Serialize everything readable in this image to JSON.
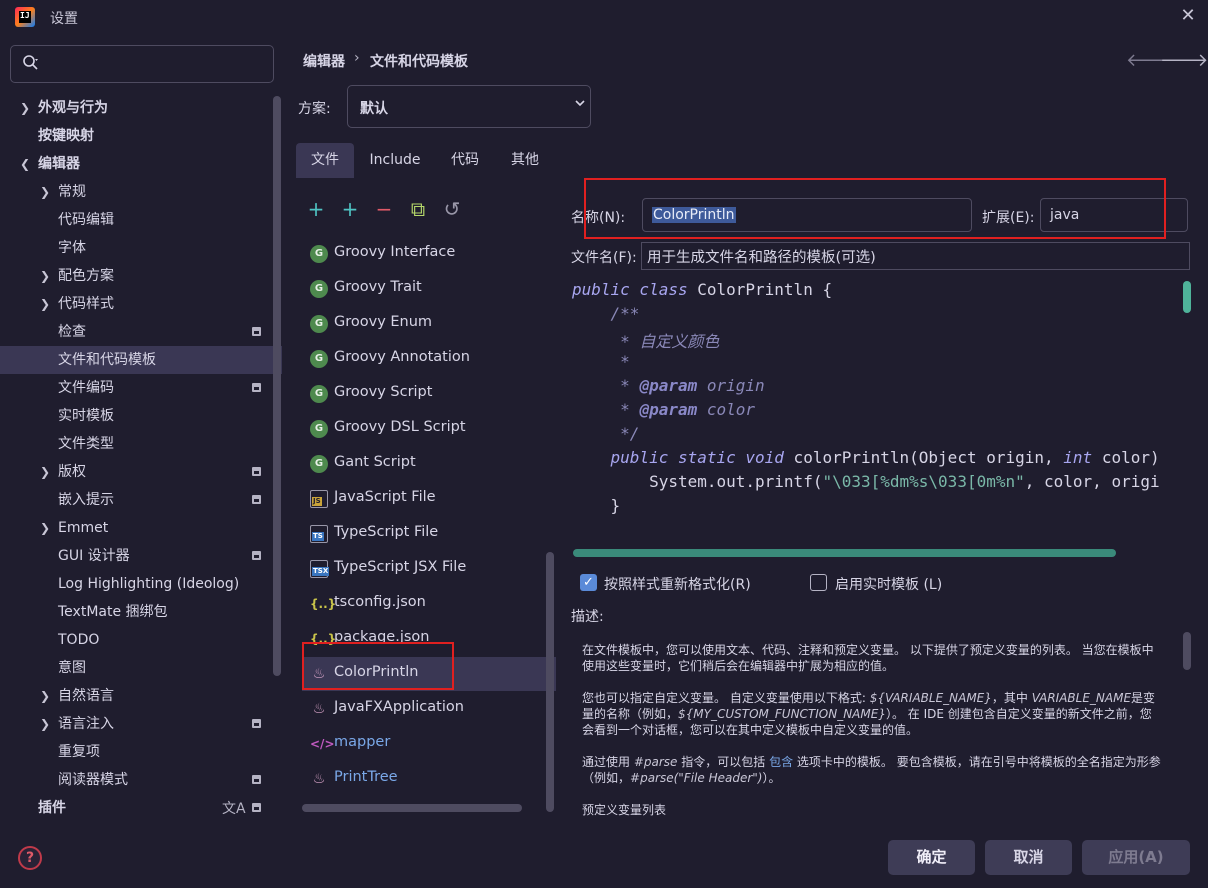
{
  "window": {
    "title": "设置",
    "close_glyph": "✕"
  },
  "search": {
    "placeholder": ""
  },
  "sidebar": {
    "items": [
      {
        "label": "外观与行为"
      },
      {
        "label": "按键映射"
      },
      {
        "label": "编辑器"
      },
      {
        "label": "常规"
      },
      {
        "label": "代码编辑"
      },
      {
        "label": "字体"
      },
      {
        "label": "配色方案"
      },
      {
        "label": "代码样式"
      },
      {
        "label": "检查"
      },
      {
        "label": "文件和代码模板"
      },
      {
        "label": "文件编码"
      },
      {
        "label": "实时模板"
      },
      {
        "label": "文件类型"
      },
      {
        "label": "版权"
      },
      {
        "label": "嵌入提示"
      },
      {
        "label": "Emmet"
      },
      {
        "label": "GUI 设计器"
      },
      {
        "label": "Log Highlighting (Ideolog)"
      },
      {
        "label": "TextMate 捆绑包"
      },
      {
        "label": "TODO"
      },
      {
        "label": "意图"
      },
      {
        "label": "自然语言"
      },
      {
        "label": "语言注入"
      },
      {
        "label": "重复项"
      },
      {
        "label": "阅读器模式"
      },
      {
        "label": "插件"
      }
    ]
  },
  "header": {
    "breadcrumb": [
      "编辑器",
      "文件和代码模板"
    ],
    "separator": "›",
    "back_glyph": "🡐",
    "forward_glyph": "🡒"
  },
  "scheme": {
    "label": "方案:",
    "value": "默认"
  },
  "tabs": [
    {
      "label": "文件"
    },
    {
      "label": "Include"
    },
    {
      "label": "代码"
    },
    {
      "label": "其他"
    }
  ],
  "toolbar": {
    "add": "+",
    "add_child": "+",
    "remove": "−",
    "copy": "⧉",
    "reset": "↺"
  },
  "templates": [
    {
      "name": "Groovy Interface",
      "icon": "G"
    },
    {
      "name": "Groovy Trait",
      "icon": "G"
    },
    {
      "name": "Groovy Enum",
      "icon": "G"
    },
    {
      "name": "Groovy Annotation",
      "icon": "G"
    },
    {
      "name": "Groovy Script",
      "icon": "G"
    },
    {
      "name": "Groovy DSL Script",
      "icon": "G"
    },
    {
      "name": "Gant Script",
      "icon": "G"
    },
    {
      "name": "JavaScript File",
      "icon": "JS"
    },
    {
      "name": "TypeScript File",
      "icon": "TS"
    },
    {
      "name": "TypeScript JSX File",
      "icon": "TSX"
    },
    {
      "name": "tsconfig.json",
      "icon": "{..}"
    },
    {
      "name": "package.json",
      "icon": "{..}"
    },
    {
      "name": "ColorPrintln",
      "icon": "♨"
    },
    {
      "name": "JavaFXApplication",
      "icon": "♨"
    },
    {
      "name": "mapper",
      "icon": "</>"
    },
    {
      "name": "PrintTree",
      "icon": "♨"
    }
  ],
  "form": {
    "name_label": "名称(N):",
    "name_value": "ColorPrintln",
    "ext_label": "扩展(E):",
    "ext_value": "java",
    "filename_label": "文件名(F):",
    "filename_placeholder": "用于生成文件名和路径的模板(可选)"
  },
  "code": {
    "l1_kw": "public class",
    "l1_rest": " ColorPrintln {",
    "l2": "    /**",
    "l3": "     * 自定义颜色",
    "l4": "     *",
    "l5_star": "     * ",
    "l5_tag": "@param",
    "l5_name": " origin",
    "l6_star": "     * ",
    "l6_tag": "@param",
    "l6_name": " color",
    "l7": "     */",
    "l8_kw": "    public static void",
    "l8_a": " colorPrintln(Object origin, ",
    "l8_kw2": "int",
    "l8_b": " color)",
    "l9_a": "        System.out.printf(",
    "l9_str": "\"\\033[%dm%s\\033[0m%n\"",
    "l9_b": ", color, origi",
    "l10": "    }"
  },
  "options": {
    "reformat_label": "按照样式重新格式化(R)",
    "reformat_checked": true,
    "live_label": "启用实时模板 (L)",
    "live_checked": false
  },
  "description": {
    "label": "描述:",
    "p1": "在文件模板中，您可以使用文本、代码、注释和预定义变量。 以下提供了预定义变量的列表。 当您在模板中使用这些变量时，它们稍后会在编辑器中扩展为相应的值。",
    "p2_a": "您也可以指定自定义变量。 自定义变量使用以下格式: ",
    "p2_v1": "${VARIABLE_NAME}",
    "p2_b": "，其中 ",
    "p2_v2": "VARIABLE_NAME",
    "p2_c": "是变量的名称（例如，",
    "p2_v3": "${MY_CUSTOM_FUNCTION_NAME}",
    "p2_d": "）。 在 IDE 创建包含自定义变量的新文件之前，您会看到一个对话框，您可以在其中定义模板中自定义变量的值。",
    "p3_a": "通过使用 ",
    "p3_v1": "#parse",
    "p3_b": " 指令，可以包括 ",
    "p3_link": "包含",
    "p3_c": " 选项卡中的模板。 要包含模板，请在引号中将模板的全名指定为形参（例如，",
    "p3_v2": "#parse(\"File Header\")",
    "p3_d": "）。",
    "p4": "预定义变量列表"
  },
  "footer": {
    "ok": "确定",
    "cancel": "取消",
    "apply": "应用(A)"
  },
  "icons": {
    "help": "?",
    "translate": "文A"
  }
}
